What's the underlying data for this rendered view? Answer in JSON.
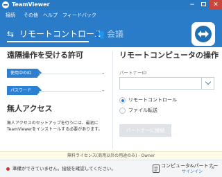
{
  "window": {
    "title": "TeamViewer",
    "min_glyph": "−",
    "close_glyph": "✕"
  },
  "menu": {
    "items": [
      "接続",
      "その他",
      "ヘルプ",
      "フィードバック"
    ]
  },
  "nav": {
    "remote_label": "リモートコントロール",
    "remote_glyph": "⇆",
    "meeting_label": "会議",
    "meeting_glyph": "👥"
  },
  "left_panel": {
    "title": "遠隔操作を受ける許可",
    "your_id_label": "使用中のID",
    "your_id_value": "-",
    "password_label": "パスワード",
    "password_value": "-",
    "unattended_title": "無人アクセス",
    "unattended_desc": "無人アクセスのセットアップを行うには、最初にTeamViewerをインストールする必要があります。"
  },
  "right_panel": {
    "title": "リモートコンピュータの操作",
    "partner_id_label": "パートナーID",
    "partner_id_value": "",
    "options": [
      {
        "label": "リモートコントロール",
        "selected": true
      },
      {
        "label": "ファイル転送",
        "selected": false
      }
    ],
    "connect_label": "パートナーに接続"
  },
  "license_text": "無料ライセンス(商用以外の用途のみ) - Owner",
  "status": {
    "text": "準備ができていません。接続を確認してください。",
    "color": "#d9302a"
  },
  "computers_partners": {
    "title": "コンピュータ&パートナー",
    "subtitle": "サインイン",
    "arrow_glyph": "»"
  },
  "colors": {
    "accent": "#2a7cc8",
    "tag": "#2d7fd1"
  }
}
